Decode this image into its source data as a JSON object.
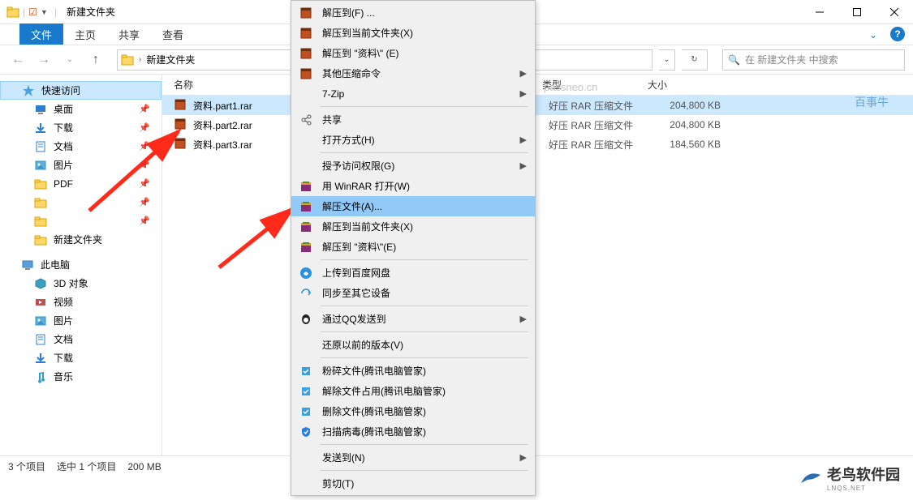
{
  "titlebar": {
    "app_title": "新建文件夹",
    "quick_icons": [
      "folder",
      "checkbox",
      "dropdown"
    ]
  },
  "ribbon": {
    "file": "文件",
    "tabs": [
      "主页",
      "共享",
      "查看"
    ]
  },
  "address": {
    "crumb": "新建文件夹",
    "search_placeholder": "在 新建文件夹 中搜索"
  },
  "sidebar": {
    "quick_access": "快速访问",
    "items": [
      {
        "label": "桌面",
        "icon": "desktop",
        "pinned": true
      },
      {
        "label": "下载",
        "icon": "download",
        "pinned": true
      },
      {
        "label": "文档",
        "icon": "document",
        "pinned": true
      },
      {
        "label": "图片",
        "icon": "pictures",
        "pinned": true
      },
      {
        "label": "PDF",
        "icon": "folder",
        "pinned": true
      },
      {
        "label": "",
        "icon": "folder",
        "pinned": true
      },
      {
        "label": "",
        "icon": "folder",
        "pinned": true
      },
      {
        "label": "新建文件夹",
        "icon": "folder",
        "pinned": false
      }
    ],
    "this_pc": "此电脑",
    "pc_items": [
      {
        "label": "3D 对象",
        "icon": "3d"
      },
      {
        "label": "视频",
        "icon": "video"
      },
      {
        "label": "图片",
        "icon": "pictures"
      },
      {
        "label": "文档",
        "icon": "document"
      },
      {
        "label": "下载",
        "icon": "download"
      },
      {
        "label": "音乐",
        "icon": "music"
      }
    ]
  },
  "columns": {
    "name": "名称",
    "type": "类型",
    "size": "大小"
  },
  "files": [
    {
      "name": "资料.part1.rar",
      "type": "好压 RAR 压缩文件",
      "size": "204,800 KB",
      "selected": true
    },
    {
      "name": "资料.part2.rar",
      "type": "好压 RAR 压缩文件",
      "size": "204,800 KB",
      "selected": false
    },
    {
      "name": "资料.part3.rar",
      "type": "好压 RAR 压缩文件",
      "size": "184,560 KB",
      "selected": false
    }
  ],
  "status": {
    "count": "3 个项目",
    "selected": "选中 1 个项目",
    "size": "200 MB"
  },
  "context_menu": [
    {
      "label": "解压到(F) ...",
      "icon": "rar"
    },
    {
      "label": "解压到当前文件夹(X)",
      "icon": "rar"
    },
    {
      "label": "解压到 \"资料\\\" (E)",
      "icon": "rar"
    },
    {
      "label": "其他压缩命令",
      "icon": "rar",
      "sub": true
    },
    {
      "label": "7-Zip",
      "icon": "",
      "sub": true
    },
    {
      "sep": true
    },
    {
      "label": "共享",
      "icon": "share"
    },
    {
      "label": "打开方式(H)",
      "icon": "",
      "sub": true
    },
    {
      "sep": true
    },
    {
      "label": "授予访问权限(G)",
      "icon": "",
      "sub": true
    },
    {
      "label": "用 WinRAR 打开(W)",
      "icon": "winrar"
    },
    {
      "label": "解压文件(A)...",
      "icon": "winrar",
      "hover": true
    },
    {
      "label": "解压到当前文件夹(X)",
      "icon": "winrar"
    },
    {
      "label": "解压到 \"资料\\\"(E)",
      "icon": "winrar"
    },
    {
      "sep": true
    },
    {
      "label": "上传到百度网盘",
      "icon": "baidu"
    },
    {
      "label": "同步至其它设备",
      "icon": "sync"
    },
    {
      "sep": true
    },
    {
      "label": "通过QQ发送到",
      "icon": "qq",
      "sub": true
    },
    {
      "sep": true
    },
    {
      "label": "还原以前的版本(V)",
      "icon": ""
    },
    {
      "sep": true
    },
    {
      "label": "粉碎文件(腾讯电脑管家)",
      "icon": "tx"
    },
    {
      "label": "解除文件占用(腾讯电脑管家)",
      "icon": "tx"
    },
    {
      "label": "删除文件(腾讯电脑管家)",
      "icon": "tx"
    },
    {
      "label": "扫描病毒(腾讯电脑管家)",
      "icon": "shield"
    },
    {
      "sep": true
    },
    {
      "label": "发送到(N)",
      "icon": "",
      "sub": true
    },
    {
      "sep": true
    },
    {
      "label": "剪切(T)",
      "icon": ""
    }
  ],
  "watermarks": {
    "wm1": "passneo.cn",
    "wm2": "百事牛",
    "logo": "老鸟软件园",
    "logo_sub": "LNQS.NET"
  }
}
